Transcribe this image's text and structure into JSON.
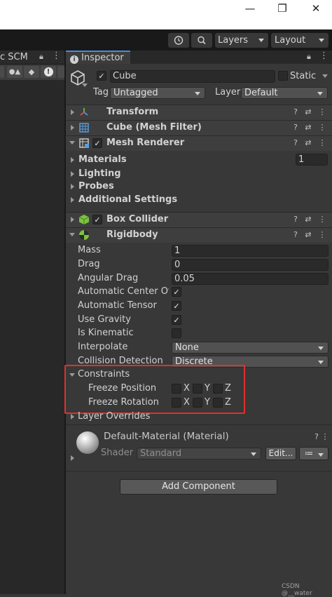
{
  "window": {
    "minimize": "—",
    "maximize": "❐",
    "close": "✕"
  },
  "toolbar": {
    "history_icon": "history-icon",
    "search_icon": "search-icon",
    "layers_label": "Layers",
    "layout_label": "Layout"
  },
  "left_panel": {
    "tab_label": "c SCM"
  },
  "inspector": {
    "tab_label": "Inspector",
    "object": {
      "name": "Cube",
      "static_label": "Static",
      "tag_label": "Tag",
      "tag_value": "Untagged",
      "layer_label": "Layer",
      "layer_value": "Default"
    },
    "components": {
      "transform": "Transform",
      "mesh_filter": "Cube (Mesh Filter)",
      "mesh_renderer": "Mesh Renderer",
      "box_collider": "Box Collider",
      "rigidbody": "Rigidbody"
    },
    "mesh_renderer": {
      "materials": "Materials",
      "materials_count": "1",
      "lighting": "Lighting",
      "probes": "Probes",
      "additional": "Additional Settings"
    },
    "rigidbody": {
      "mass_label": "Mass",
      "mass": "1",
      "drag_label": "Drag",
      "drag": "0",
      "angular_drag_label": "Angular Drag",
      "angular_drag": "0.05",
      "auto_com_label": "Automatic Center Of M",
      "auto_tensor_label": "Automatic Tensor",
      "gravity_label": "Use Gravity",
      "kinematic_label": "Is Kinematic",
      "interpolate_label": "Interpolate",
      "interpolate": "None",
      "collision_label": "Collision Detection",
      "collision": "Discrete",
      "constraints_label": "Constraints",
      "freeze_pos_label": "Freeze Position",
      "freeze_rot_label": "Freeze Rotation",
      "axis_x": "X",
      "axis_y": "Y",
      "axis_z": "Z",
      "layer_overrides": "Layer Overrides"
    },
    "material": {
      "name": "Default-Material (Material)",
      "shader_label": "Shader",
      "shader_value": "Standard",
      "edit_label": "Edit...",
      "list_icon": "≔"
    },
    "add_component": "Add Component"
  },
  "footer": {
    "watermark": "CSDN @__water"
  }
}
